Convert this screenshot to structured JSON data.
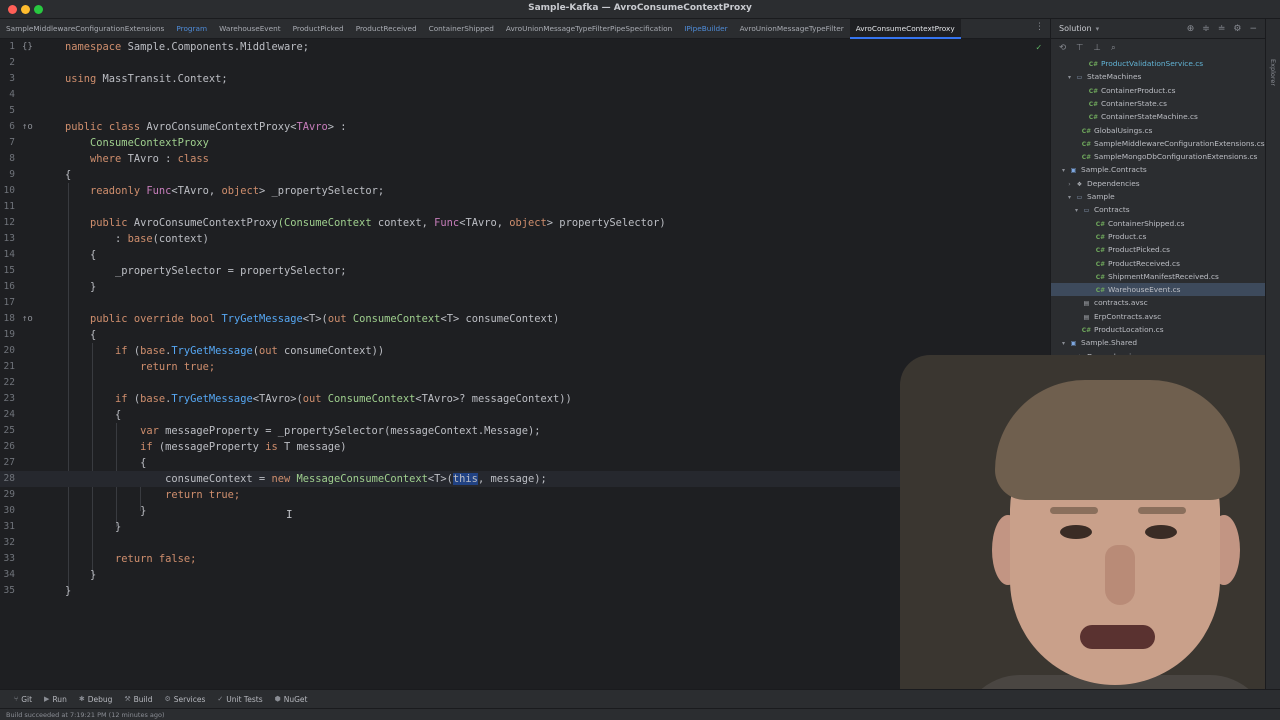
{
  "window": {
    "title": "Sample-Kafka — AvroConsumeContextProxy"
  },
  "tabs": [
    {
      "label": "SampleMiddlewareConfigurationExtensions",
      "style": "normal"
    },
    {
      "label": "Program",
      "style": "accent"
    },
    {
      "label": "WarehouseEvent",
      "style": "normal"
    },
    {
      "label": "ProductPicked",
      "style": "normal"
    },
    {
      "label": "ProductReceived",
      "style": "normal"
    },
    {
      "label": "ContainerShipped",
      "style": "normal"
    },
    {
      "label": "AvroUnionMessageTypeFilterPipeSpecification",
      "style": "normal"
    },
    {
      "label": "IPipeBuilder",
      "style": "accent"
    },
    {
      "label": "AvroUnionMessageTypeFilter",
      "style": "normal"
    },
    {
      "label": "AvroConsumeContextProxy",
      "style": "active"
    }
  ],
  "editor": {
    "lines": [
      "1",
      "2",
      "3",
      "4",
      "5",
      "6",
      "7",
      "8",
      "9",
      "10",
      "11",
      "12",
      "13",
      "14",
      "15",
      "16",
      "17",
      "18",
      "19",
      "20",
      "21",
      "22",
      "23",
      "24",
      "25",
      "26",
      "27",
      "28",
      "29",
      "30",
      "31",
      "32",
      "33",
      "34",
      "35"
    ],
    "t": {
      "namespace": "namespace",
      "ns_name": "Sample.Components.Middleware;",
      "using": "using",
      "using_ns": "MassTransit.Context;",
      "public": "public",
      "class": "class",
      "cls_name": "AvroConsumeContextProxy",
      "lt": "<",
      "tavro": "TAvro",
      "gt_colon": "> :",
      "base_cls": "ConsumeContextProxy",
      "where": "where",
      "tavro_colon": "TAvro :",
      "open_brace": "{",
      "close_brace": "}",
      "readonly": "readonly",
      "func": "Func",
      "func_args_a": "<TAvro,",
      "object": "object",
      "field_decl": "> _propertySelector;",
      "ctor_name": "AvroConsumeContextProxy",
      "ctor_p1_type": "(ConsumeContext",
      "ctor_p1_name": " context,",
      "ctor_p2_tail": "> propertySelector)",
      "base_call_pre": ": ",
      "base_kw": "base",
      "base_call_post": "(context)",
      "assign_field": "_propertySelector = propertySelector;",
      "override": "override",
      "bool": "bool",
      "trygm": "TryGetMessage",
      "trygm_sig": "<T>(",
      "out": "out",
      "cc_t": "ConsumeContext",
      "cc_t_tail": "<T> consumeContext)",
      "if": "if",
      "if1_pre": " (",
      "base_dot": ".",
      "if1_post": "(",
      "if1_out_tail": " consumeContext))",
      "return": "return",
      "true_semi": "true;",
      "if2_generic": "<TAvro>(",
      "if2_tail": "<TAvro>? messageContext))",
      "var": "var",
      "msgprop_decl": " messageProperty = ",
      "selector_call": "_propertySelector",
      "selector_args": "(messageContext.Message);",
      "if3_tail": " (messageProperty ",
      "is": "is",
      "if3_t": " T message)",
      "assign_cc": "consumeContext = ",
      "new": "new",
      "mcc": "MessageConsumeContext",
      "mcc_generic": "<T>(",
      "this": "this",
      "mcc_tail": ", message);",
      "false_semi": "false;"
    }
  },
  "solution": {
    "title": "Solution",
    "items": [
      {
        "label": "ProductValidationService.cs",
        "icon": "C#",
        "kind": "cs",
        "arrow": "",
        "indent": 28,
        "highlight": true
      },
      {
        "label": "StateMachines",
        "icon": "▭",
        "kind": "folder",
        "arrow": "▾",
        "indent": 14
      },
      {
        "label": "ContainerProduct.cs",
        "icon": "C#",
        "kind": "cs",
        "arrow": "",
        "indent": 28
      },
      {
        "label": "ContainerState.cs",
        "icon": "C#",
        "kind": "cs",
        "arrow": "",
        "indent": 28
      },
      {
        "label": "ContainerStateMachine.cs",
        "icon": "C#",
        "kind": "cs",
        "arrow": "",
        "indent": 28
      },
      {
        "label": "GlobalUsings.cs",
        "icon": "C#",
        "kind": "cs",
        "arrow": "",
        "indent": 21
      },
      {
        "label": "SampleMiddlewareConfigurationExtensions.cs",
        "icon": "C#",
        "kind": "cs",
        "arrow": "",
        "indent": 21
      },
      {
        "label": "SampleMongoDbConfigurationExtensions.cs",
        "icon": "C#",
        "kind": "cs",
        "arrow": "",
        "indent": 21
      },
      {
        "label": "Sample.Contracts",
        "icon": "▣",
        "kind": "proj",
        "arrow": "▾",
        "indent": 8
      },
      {
        "label": "Dependencies",
        "icon": "❖",
        "kind": "dep",
        "arrow": "›",
        "indent": 14
      },
      {
        "label": "Sample",
        "icon": "▭",
        "kind": "folder",
        "arrow": "▾",
        "indent": 14
      },
      {
        "label": "Contracts",
        "icon": "▭",
        "kind": "folder",
        "arrow": "▾",
        "indent": 21
      },
      {
        "label": "ContainerShipped.cs",
        "icon": "C#",
        "kind": "cs",
        "arrow": "",
        "indent": 35
      },
      {
        "label": "Product.cs",
        "icon": "C#",
        "kind": "cs",
        "arrow": "",
        "indent": 35
      },
      {
        "label": "ProductPicked.cs",
        "icon": "C#",
        "kind": "cs",
        "arrow": "",
        "indent": 35
      },
      {
        "label": "ProductReceived.cs",
        "icon": "C#",
        "kind": "cs",
        "arrow": "",
        "indent": 35
      },
      {
        "label": "ShipmentManifestReceived.cs",
        "icon": "C#",
        "kind": "cs",
        "arrow": "",
        "indent": 35
      },
      {
        "label": "WarehouseEvent.cs",
        "icon": "C#",
        "kind": "cs",
        "arrow": "",
        "indent": 35,
        "selected": true
      },
      {
        "label": "contracts.avsc",
        "icon": "▤",
        "kind": "file",
        "arrow": "",
        "indent": 21
      },
      {
        "label": "ErpContracts.avsc",
        "icon": "▤",
        "kind": "file",
        "arrow": "",
        "indent": 21
      },
      {
        "label": "ProductLocation.cs",
        "icon": "C#",
        "kind": "cs",
        "arrow": "",
        "indent": 21
      },
      {
        "label": "Sample.Shared",
        "icon": "▣",
        "kind": "proj",
        "arrow": "▾",
        "indent": 8
      },
      {
        "label": "Dependencies",
        "icon": "❖",
        "kind": "dep",
        "arrow": "›",
        "indent": 14
      }
    ]
  },
  "sidebar_strip": {
    "label": "Explorer"
  },
  "toolwindows": [
    {
      "label": "Git",
      "icon": "⑂"
    },
    {
      "label": "Run",
      "icon": "▶"
    },
    {
      "label": "Debug",
      "icon": "✱"
    },
    {
      "label": "Build",
      "icon": "⚒"
    },
    {
      "label": "Services",
      "icon": "⚙"
    },
    {
      "label": "Unit Tests",
      "icon": "✓"
    },
    {
      "label": "NuGet",
      "icon": "⬢"
    }
  ],
  "status": {
    "text": "Build succeeded at 7:19:21 PM  (12 minutes ago)"
  },
  "colors": {
    "background": "#1e1f22",
    "keyword": "#cf8e6d",
    "type_param": "#c77dbb",
    "class_name": "#9fcf8e",
    "method": "#56a8f5",
    "selection": "#214283",
    "accent": "#3574f0"
  }
}
